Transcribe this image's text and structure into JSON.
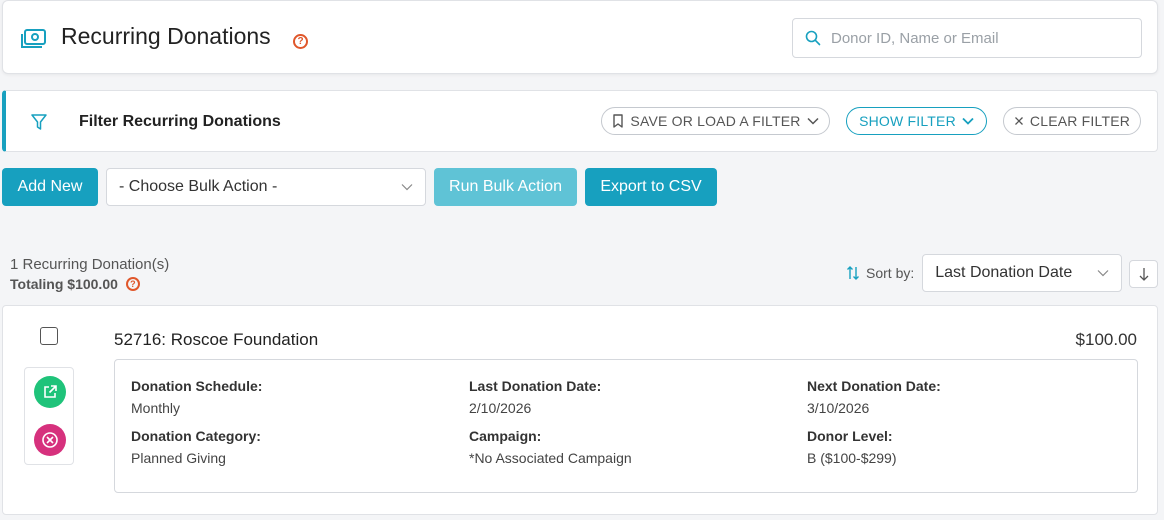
{
  "header": {
    "title": "Recurring Donations",
    "help_icon": "question-circle-icon",
    "page_icon": "money-bill-icon",
    "search_placeholder": "Donor ID, Name or Email"
  },
  "filter": {
    "title": "Filter Recurring Donations",
    "save_load_label": "SAVE OR LOAD A FILTER",
    "show_filter_label": "SHOW FILTER",
    "clear_filter_label": "CLEAR FILTER"
  },
  "toolbar": {
    "add_new_label": "Add New",
    "bulk_action_value": "- Choose Bulk Action -",
    "run_bulk_label": "Run Bulk Action",
    "export_label": "Export to CSV"
  },
  "summary": {
    "count_text": "1 Recurring Donation(s)",
    "total_text": "Totaling $100.00"
  },
  "sort": {
    "label": "Sort by:",
    "value": "Last Donation Date"
  },
  "donations": [
    {
      "title": "52716: Roscoe Foundation",
      "amount": "$100.00",
      "schedule_label": "Donation Schedule:",
      "schedule_value": "Monthly",
      "last_date_label": "Last Donation Date:",
      "last_date_value": "2/10/2026",
      "next_date_label": "Next Donation Date:",
      "next_date_value": "3/10/2026",
      "category_label": "Donation Category:",
      "category_value": "Planned Giving",
      "campaign_label": "Campaign:",
      "campaign_value": "*No Associated Campaign",
      "level_label": "Donor Level:",
      "level_value": "B ($100-$299)"
    }
  ],
  "colors": {
    "accent": "#17a0bf",
    "accent_light": "#5fc3d6",
    "help": "#e0572b",
    "open_btn": "#1fc37a",
    "cancel_btn": "#d6317d"
  }
}
